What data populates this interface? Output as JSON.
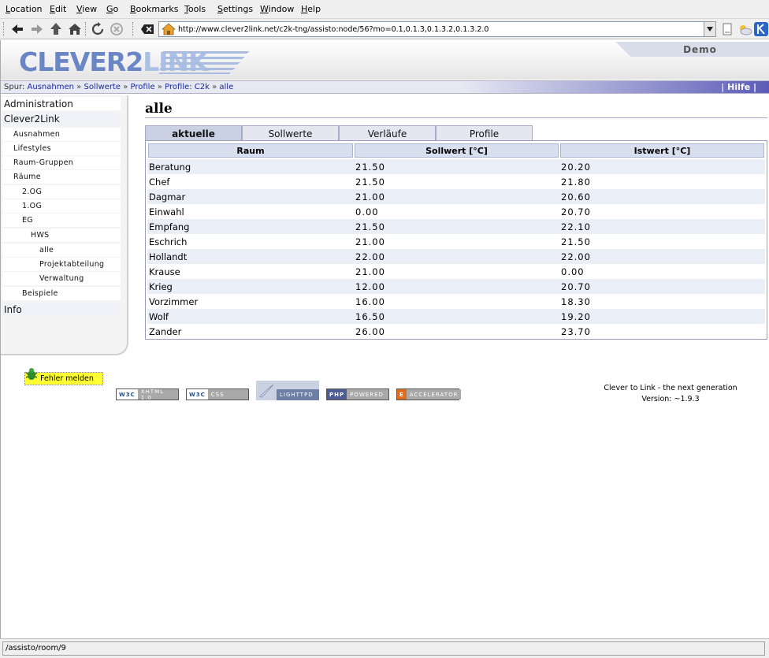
{
  "menubar": {
    "items": [
      {
        "label": "Location"
      },
      {
        "label": "Edit"
      },
      {
        "label": "View"
      },
      {
        "label": "Go"
      },
      {
        "label": "Bookmarks"
      },
      {
        "label": "Tools"
      },
      {
        "label": "Settings"
      },
      {
        "label": "Window"
      },
      {
        "label": "Help"
      }
    ]
  },
  "toolbar": {
    "url": "http://www.clever2link.net/c2k-tng/assisto:node/56?mo=0.1,0.1.3,0.1.3.2,0.1.3.2.0",
    "icons": [
      "back-icon",
      "forward-icon",
      "up-icon",
      "home-icon",
      "reload-icon",
      "stop-icon",
      "clear-location-icon",
      "location-home-icon",
      "dropdown-icon",
      "bookmark-icon",
      "weather-icon",
      "konqueror-logo-icon"
    ]
  },
  "header": {
    "logo_part1": "CLEVER2",
    "logo_part2": "LINK",
    "user_label": "Demo"
  },
  "breadcrumb": {
    "prefix": "Spur:",
    "items": [
      "Ausnahmen",
      "Sollwerte",
      "Profile",
      "Profile: C2k",
      "alle"
    ],
    "separator": "»",
    "help_label": "| Hilfe |"
  },
  "sidebar": {
    "items": [
      {
        "label": "Administration"
      },
      {
        "label": "Clever2Link"
      },
      {
        "label": "Ausnahmen"
      },
      {
        "label": "Lifestyles"
      },
      {
        "label": "Raum-Gruppen"
      },
      {
        "label": "Räume"
      },
      {
        "label": "2.OG"
      },
      {
        "label": "1.OG"
      },
      {
        "label": "EG"
      },
      {
        "label": "HWS"
      },
      {
        "label": "alle"
      },
      {
        "label": "Projektabteilung"
      },
      {
        "label": "Verwaltung"
      },
      {
        "label": "Beispiele"
      },
      {
        "label": "Info"
      }
    ],
    "report_button": "Fehler melden"
  },
  "main": {
    "title": "alle",
    "tabs": [
      {
        "label": "aktuelle",
        "active": true
      },
      {
        "label": "Sollwerte",
        "active": false
      },
      {
        "label": "Verläufe",
        "active": false
      },
      {
        "label": "Profile",
        "active": false
      }
    ],
    "table": {
      "headers": [
        "Raum",
        "Sollwert [°C]",
        "Istwert [°C]"
      ],
      "rows": [
        [
          "Beratung",
          "21.50",
          "20.20"
        ],
        [
          "Chef",
          "21.50",
          "21.80"
        ],
        [
          "Dagmar",
          "21.00",
          "20.60"
        ],
        [
          "Einwahl",
          "0.00",
          "20.70"
        ],
        [
          "Empfang",
          "21.50",
          "22.10"
        ],
        [
          "Eschrich",
          "21.00",
          "21.50"
        ],
        [
          "Hollandt",
          "22.00",
          "22.00"
        ],
        [
          "Krause",
          "21.00",
          "0.00"
        ],
        [
          "Krieg",
          "12.00",
          "20.70"
        ],
        [
          "Vorzimmer",
          "16.00",
          "18.30"
        ],
        [
          "Wolf",
          "16.50",
          "19.20"
        ],
        [
          "Zander",
          "26.00",
          "23.70"
        ]
      ]
    }
  },
  "footer": {
    "badges": [
      {
        "left": "W3C",
        "right": "XHTML 1.0"
      },
      {
        "left": "W3C",
        "right": "CSS"
      },
      {
        "left": "",
        "right": "LIGHTTPD"
      },
      {
        "left": "PHP",
        "right": "POWERED"
      },
      {
        "left": "E",
        "right": "ACCELERATOR"
      }
    ],
    "tagline": "Clever to Link - the next generation",
    "version": "Version: ~1.9.3"
  },
  "statusbar": {
    "text": "/assisto/room/9"
  },
  "colors": {
    "logo_dark": "#6a86c4",
    "logo_light": "#aac0e6",
    "breadcrumb_link": "#1a2a99",
    "table_header": "#d8e0ef",
    "row_alt": "#eaeef6",
    "report_button": "#ffff33"
  }
}
